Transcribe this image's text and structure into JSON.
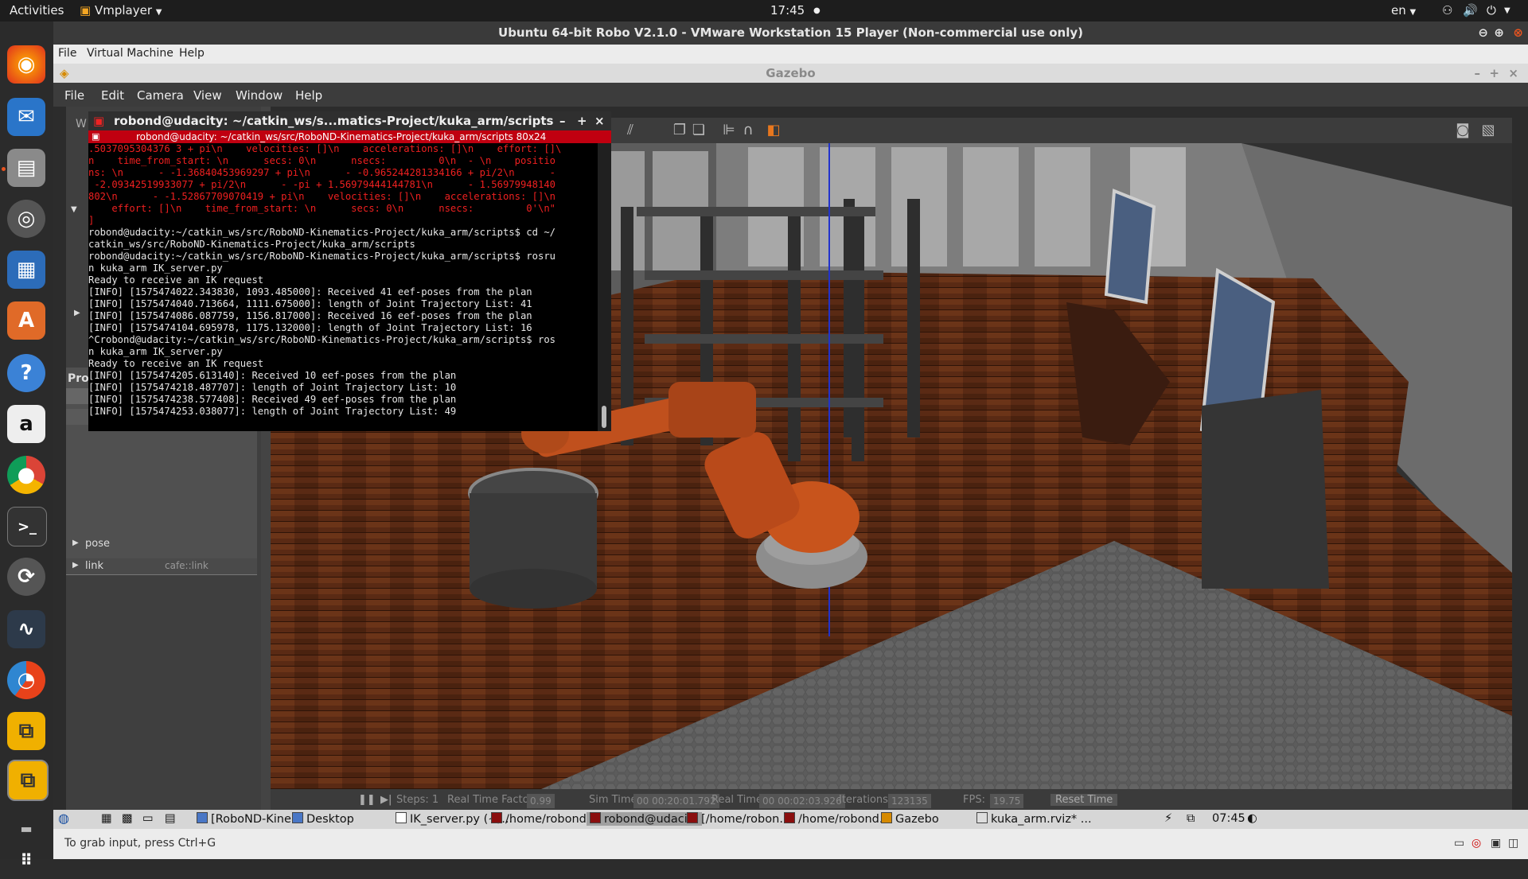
{
  "topbar": {
    "activities": "Activities",
    "app": "Vmplayer",
    "clock": "17:45",
    "lang": "en"
  },
  "vm": {
    "title": "Ubuntu 64-bit Robo V2.1.0 - VMware Workstation 15 Player (Non-commercial use only)",
    "menu": [
      "File",
      "Virtual Machine",
      "Help"
    ]
  },
  "gazebo": {
    "title": "Gazebo",
    "menu": [
      "File",
      "Edit",
      "Camera",
      "View",
      "Window",
      "Help"
    ],
    "left_tab": "W",
    "left_label": "Pro",
    "props": [
      {
        "name": "pose",
        "value": ""
      },
      {
        "name": "link",
        "value": "cafe::link"
      }
    ],
    "status": {
      "steps": "Steps: 1",
      "rtf": "Real Time Factor:",
      "rtf_val": "0.99",
      "sim": "Sim Time:",
      "sim_val": "00 00:20:01.792",
      "real": "Real Time:",
      "real_val": "00 00:02:03.926",
      "iter": "Iterations:",
      "iter_val": "123135",
      "fps": "FPS:",
      "fps_val": "19.75",
      "reset": "Reset Time"
    }
  },
  "terminal": {
    "title": "robond@udacity: ~/catkin_ws/s...matics-Project/kuka_arm/scripts",
    "tab": "robond@udacity: ~/catkin_ws/src/RoboND-Kinematics-Project/kuka_arm/scripts 80x24",
    "lines_red": [
      ".5037095304376 3 + pi\\n    velocities: []\\n    accelerations: []\\n    effort: []\\",
      "n    time_from_start: \\n      secs: 0\\n      nsecs:         0\\n  - \\n    positio",
      "ns: \\n      - -1.36840453969297 + pi\\n      - -0.965244281334166 + pi/2\\n      -",
      " -2.09342519933077 + pi/2\\n      - -pi + 1.56979444144781\\n      - 1.56979948140",
      "802\\n      - -1.52867709070419 + pi\\n    velocities: []\\n    accelerations: []\\n",
      "    effort: []\\n    time_from_start: \\n      secs: 0\\n      nsecs:         0'\\n\"",
      "]"
    ],
    "lines_white": [
      "robond@udacity:~/catkin_ws/src/RoboND-Kinematics-Project/kuka_arm/scripts$ cd ~/",
      "catkin_ws/src/RoboND-Kinematics-Project/kuka_arm/scripts",
      "robond@udacity:~/catkin_ws/src/RoboND-Kinematics-Project/kuka_arm/scripts$ rosru",
      "n kuka_arm IK_server.py",
      "Ready to receive an IK request",
      "[INFO] [1575474022.343830, 1093.485000]: Received 41 eef-poses from the plan",
      "[INFO] [1575474040.713664, 1111.675000]: length of Joint Trajectory List: 41",
      "[INFO] [1575474086.087759, 1156.817000]: Received 16 eef-poses from the plan",
      "[INFO] [1575474104.695978, 1175.132000]: length of Joint Trajectory List: 16",
      "^Crobond@udacity:~/catkin_ws/src/RoboND-Kinematics-Project/kuka_arm/scripts$ ros",
      "n kuka_arm IK_server.py",
      "Ready to receive an IK request",
      "[INFO] [1575474205.613140]: Received 10 eef-poses from the plan",
      "[INFO] [1575474218.487707]: length of Joint Trajectory List: 10",
      "[INFO] [1575474238.577408]: Received 49 eef-poses from the plan",
      "[INFO] [1575474253.038077]: length of Joint Trajectory List: 49"
    ]
  },
  "taskbar": {
    "items": [
      "[RoboND-Kine...",
      "Desktop",
      "IK_server.py (~/...",
      "/home/robond...",
      "robond@udaci...",
      "[/home/robon...",
      "/home/robond...",
      "Gazebo",
      "kuka_arm.rviz* ..."
    ],
    "time": "07:45"
  },
  "vm_status": "To grab input, press Ctrl+G"
}
